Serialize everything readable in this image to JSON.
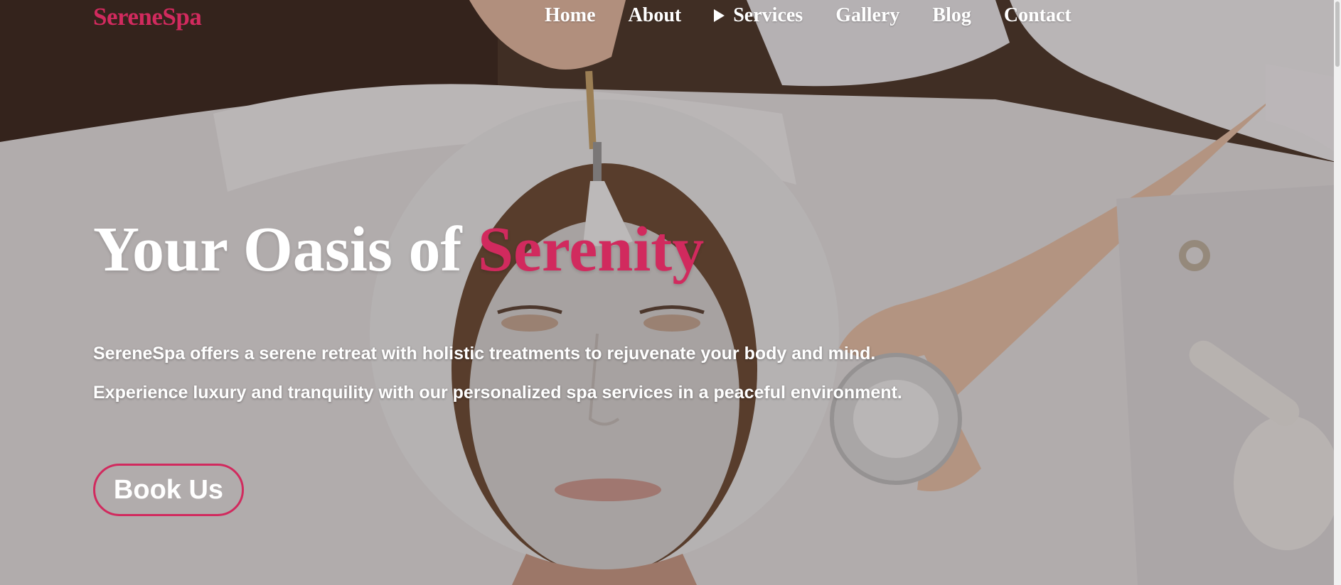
{
  "brand": {
    "name": "SereneSpa",
    "accent_color": "#d12a5e"
  },
  "nav": {
    "items": [
      {
        "label": "Home"
      },
      {
        "label": "About"
      },
      {
        "label": "Services",
        "icon": "caret-right-icon"
      },
      {
        "label": "Gallery"
      },
      {
        "label": "Blog"
      },
      {
        "label": "Contact"
      }
    ]
  },
  "hero": {
    "title_main": "Your Oasis of ",
    "title_accent": "Serenity",
    "text_line1": "SereneSpa offers a serene retreat with holistic treatments to rejuvenate your body and mind.",
    "text_line2": "Experience luxury and tranquility with our personalized spa services in a peaceful environment.",
    "cta_label": "Book Us"
  }
}
